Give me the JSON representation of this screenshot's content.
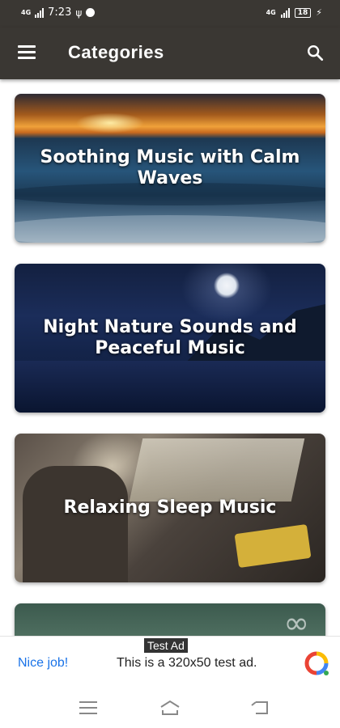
{
  "status_bar": {
    "network_left": "4G",
    "time": "7:23",
    "network_right": "4G",
    "battery": "18"
  },
  "app_bar": {
    "title": "Categories",
    "menu_icon": "hamburger-menu-icon",
    "search_icon": "search-icon",
    "background_color": "#3a3733"
  },
  "categories": [
    {
      "title": "Soothing Music with Calm Waves",
      "image": "sunset-ocean-waves"
    },
    {
      "title": "Night Nature Sounds and Peaceful Music",
      "image": "moonlit-night-meadow"
    },
    {
      "title": "Relaxing Sleep Music",
      "image": "child-sleeping-in-car"
    },
    {
      "title": "",
      "image": "forest-with-infinity-logo"
    }
  ],
  "ad": {
    "badge": "Test Ad",
    "cta": "Nice job!",
    "text": "This is a 320x50 test ad.",
    "logo_icon": "admob-logo-icon",
    "cta_color": "#1a73e8"
  },
  "nav_bar": {
    "buttons": [
      "menu-icon",
      "home-icon",
      "back-icon"
    ]
  }
}
